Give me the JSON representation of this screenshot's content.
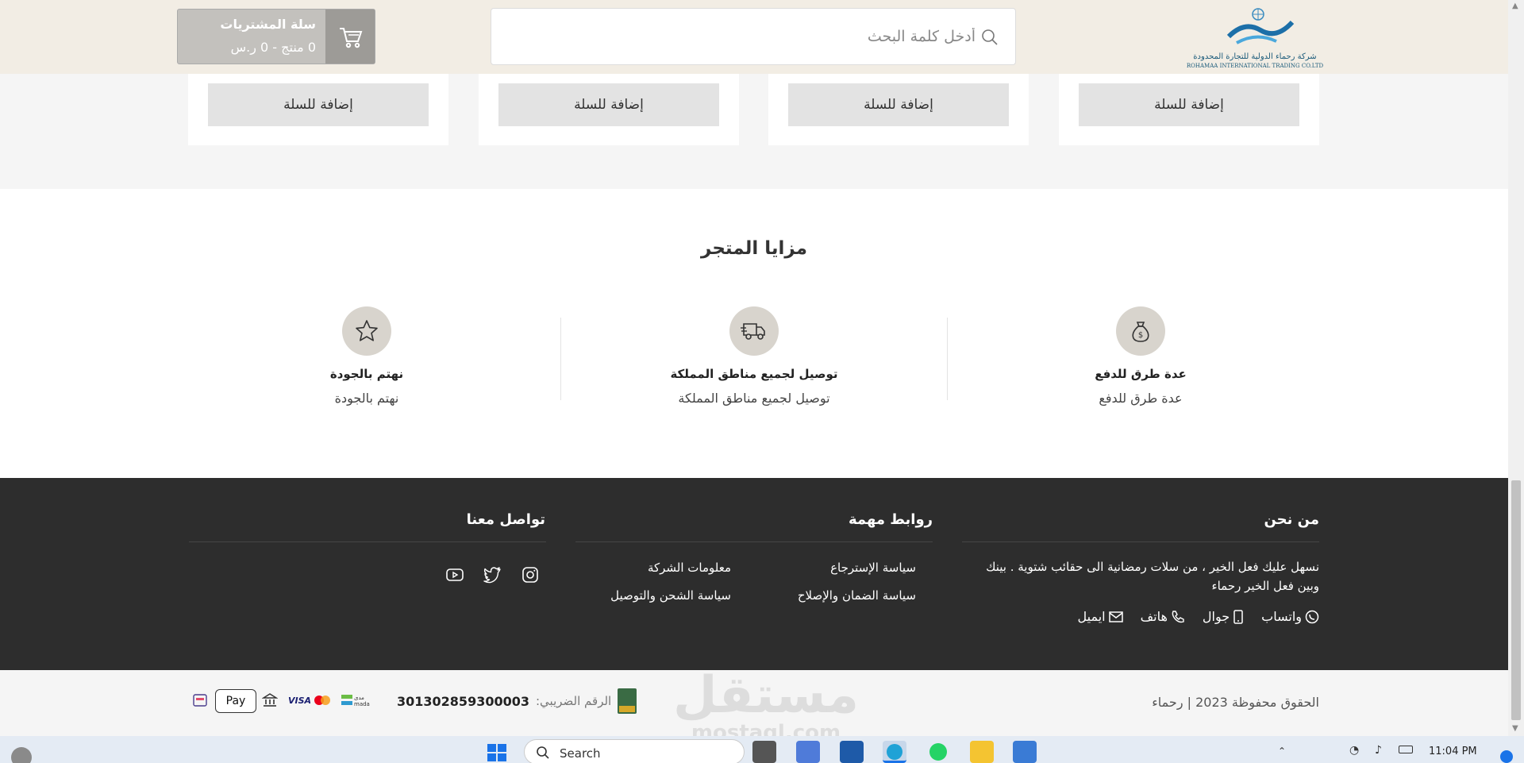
{
  "header": {
    "logo_text_ar": "شركة رحماء الدولية للتجارة المحدودة",
    "logo_text_en": "ROHAMAA INTERNATIONAL TRADING CO.LTD",
    "search_placeholder": "أدخل كلمة البحث",
    "cart_title": "سلة المشتريات",
    "cart_summary": "0 منتج - 0 ر.س"
  },
  "products": {
    "add_to_cart_label": "إضافة للسلة"
  },
  "features": {
    "title": "مزايا المتجر",
    "items": [
      {
        "title": "عدة طرق للدفع",
        "desc": "عدة طرق للدفع",
        "icon": "money-bag-icon"
      },
      {
        "title": "توصيل لجميع مناطق المملكة",
        "desc": "توصيل لجميع مناطق المملكة",
        "icon": "delivery-truck-icon"
      },
      {
        "title": "نهتم بالجودة",
        "desc": "نهتم بالجودة",
        "icon": "star-icon"
      }
    ]
  },
  "footer": {
    "about_title": "من نحن",
    "about_text": "نسهل عليك فعل الخير ، من سلات رمضانية الى حقائب شتوية . بينك وبين فعل الخير رحماء",
    "contacts": [
      "واتساب",
      "جوال",
      "هاتف",
      "ايميل"
    ],
    "links_title": "روابط مهمة",
    "links": [
      "سياسة الإسترجاع",
      "معلومات الشركة",
      "سياسة الضمان والإصلاح",
      "سياسة الشحن والتوصيل"
    ],
    "contact_title": "تواصل معنا"
  },
  "bottom": {
    "copyright": "الحقوق محفوظة  2023 | رحماء",
    "tax_label": "الرقم الضريبي:",
    "tax_number": "301302859300003",
    "watermark_top": "مستقل",
    "watermark_bottom": "mostaql.com",
    "payments": [
      "mada",
      "visa-mastercard",
      "bank",
      "apple-pay",
      "stc-pay"
    ],
    "apple_pay_label": "Pay"
  },
  "taskbar": {
    "search_label": "Search",
    "time": "11:04 PM"
  },
  "colors": {
    "header_bg": "#f2ede4",
    "footer_bg": "#2d2d2d",
    "feature_icon_bg": "#d8d4cd",
    "cart_bg": "#c3c1bd"
  }
}
